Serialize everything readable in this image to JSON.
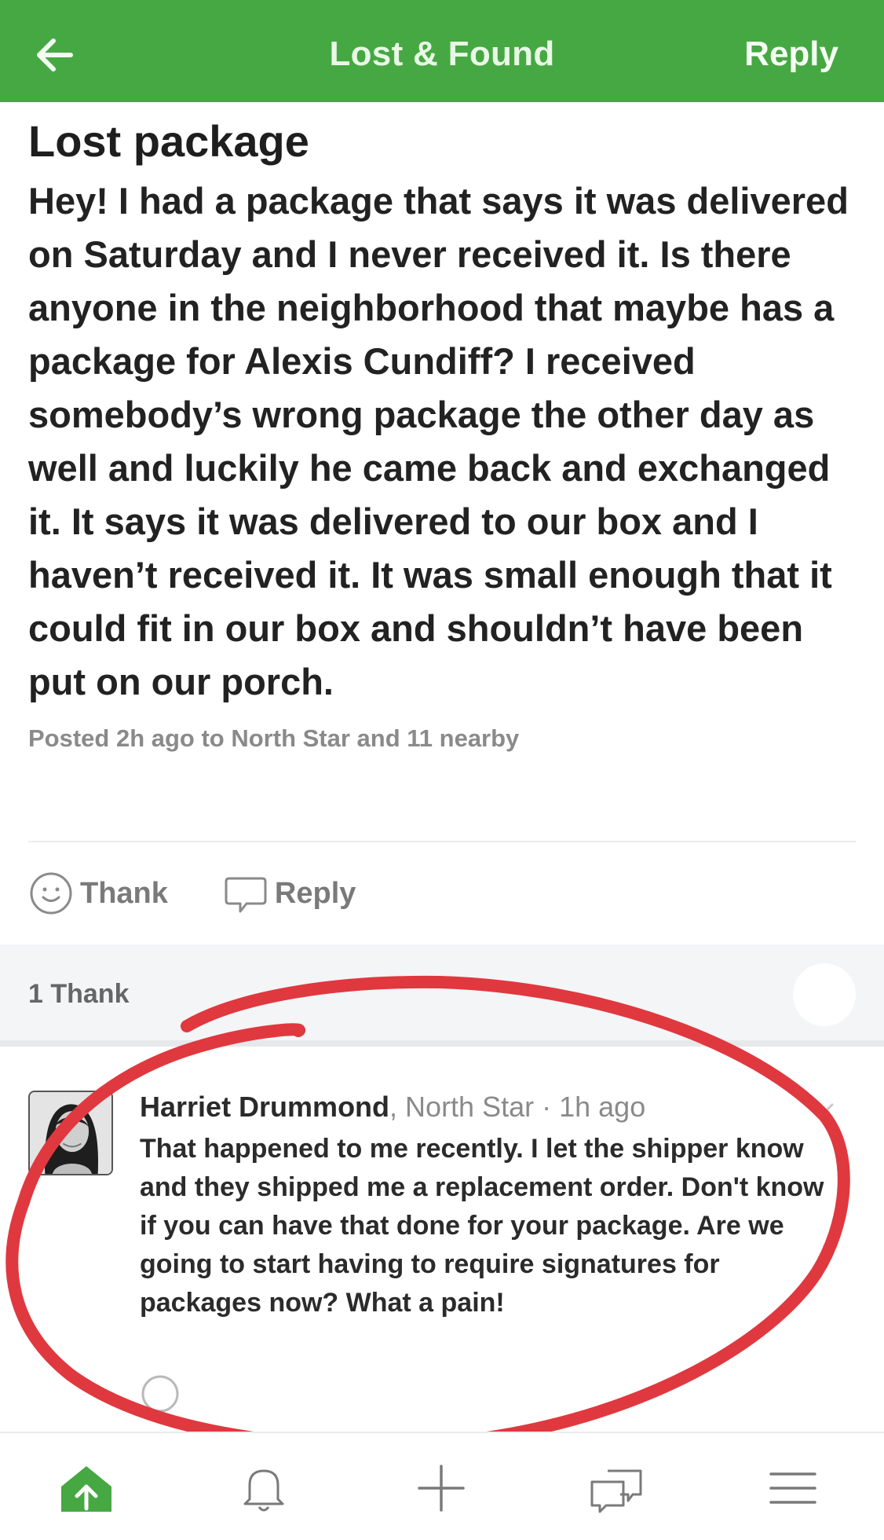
{
  "header": {
    "title": "Lost & Found",
    "reply_label": "Reply",
    "back_icon": "arrow-left-icon",
    "background": "#46a843"
  },
  "post": {
    "title": "Lost package",
    "body": "Hey! I had a package that says it was delivered on Saturday and I never received it. Is there anyone in the neighborhood that maybe has a package for Alexis Cundiff? I received somebody’s wrong package the other day as well and luckily he came back and exchanged it. It says it was delivered to our box and I haven’t received it. It was small enough that it could fit in our box and shouldn’t have been put on our porch.",
    "meta": "Posted 2h ago to North Star and 11 nearby"
  },
  "actions": {
    "thank_label": "Thank",
    "reply_label": "Reply"
  },
  "thanks_bar": {
    "count_label": "1 Thank"
  },
  "comment": {
    "author": "Harriet Drummond",
    "location_time": ", North Star · 1h ago",
    "text": "That happened to me recently. I let the shipper know and they shipped me a replacement order. Don't know if you can have that done for your package. Are we going to start having to require signatures for packages now? What a pain!"
  },
  "annotation": {
    "color": "#e0383f"
  },
  "bottom_nav": {
    "items": [
      "home-icon",
      "bell-icon",
      "plus-icon",
      "chat-icon",
      "menu-icon"
    ],
    "active_color": "#46a843"
  }
}
